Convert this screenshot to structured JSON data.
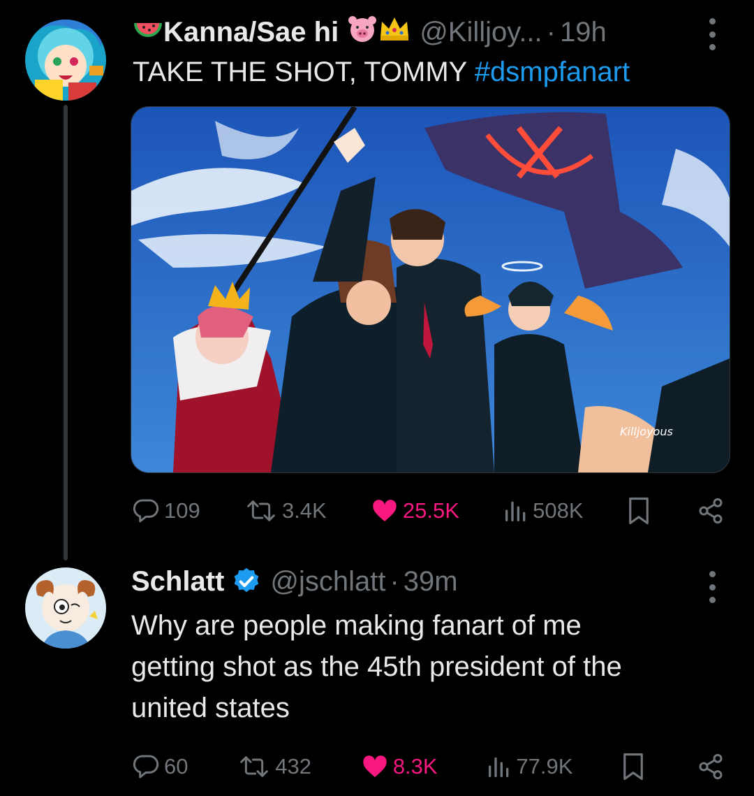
{
  "tweets": [
    {
      "display_name": "Kanna/Sae hi",
      "handle": "@Killjoy...",
      "separator": "·",
      "time": "19h",
      "text": "TAKE THE SHOT, TOMMY",
      "hashtag": "#dsmpfanart",
      "image_signature": "Killjoyous",
      "stats": {
        "replies": "109",
        "retweets": "3.4K",
        "likes": "25.5K",
        "views": "508K"
      }
    },
    {
      "display_name": "Schlatt",
      "handle": "@jschlatt",
      "separator": "·",
      "time": "39m",
      "text_lines": [
        "Why are people making fanart of me",
        "getting shot as the 45th president of the",
        "united states"
      ],
      "stats": {
        "replies": "60",
        "retweets": "432",
        "likes": "8.3K",
        "views": "77.9K"
      }
    }
  ],
  "icons": {
    "reply": "reply-icon",
    "retweet": "retweet-icon",
    "like": "heart-icon",
    "views": "views-icon",
    "bookmark": "bookmark-icon",
    "share": "share-icon",
    "verified": "verified-badge-icon",
    "more": "more-vertical-icon"
  },
  "colors": {
    "background": "#000000",
    "text": "#e7e9ea",
    "muted": "#71767b",
    "accent": "#1d9bf0",
    "like": "#f91880"
  }
}
